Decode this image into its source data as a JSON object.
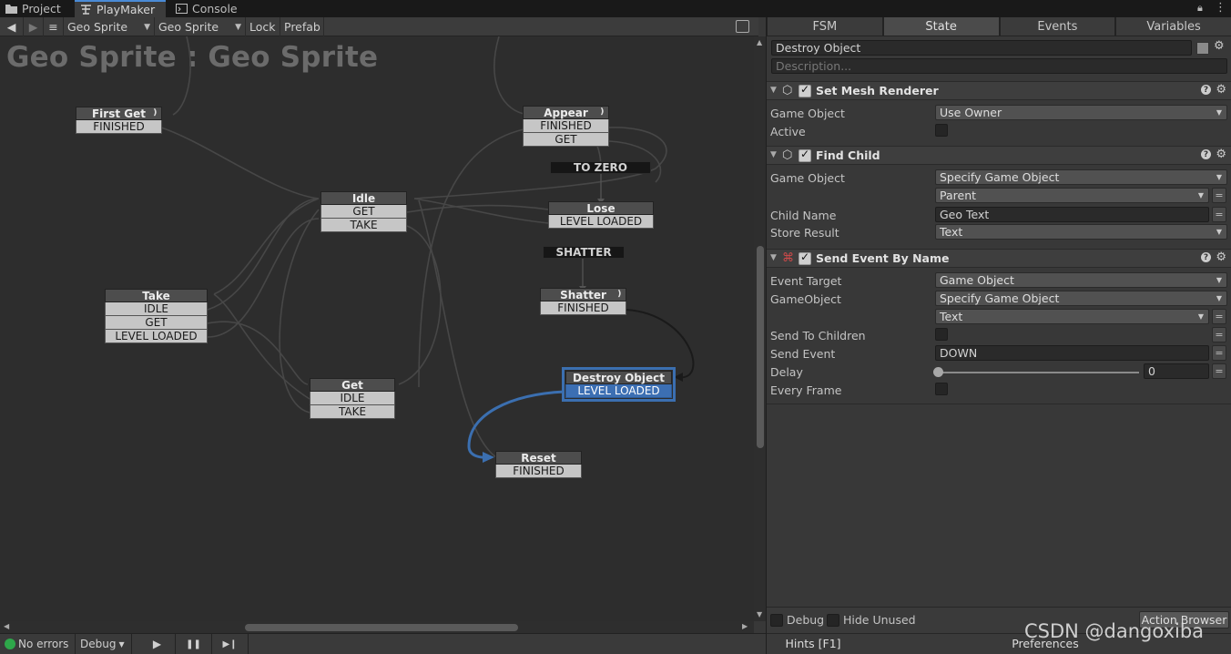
{
  "window_tabs": [
    {
      "label": "Project",
      "icon": "folder-icon"
    },
    {
      "label": "PlayMaker",
      "icon": "playmaker-icon"
    },
    {
      "label": "Console",
      "icon": "console-icon"
    }
  ],
  "toolbar": {
    "back": "◀",
    "forward": "▶",
    "menu": "≡",
    "object_select": "Geo Sprite",
    "fsm_select": "Geo Sprite",
    "lock": "Lock",
    "prefab": "Prefab"
  },
  "graph": {
    "title": "Geo Sprite : Geo Sprite",
    "global_events": [
      "TO ZERO",
      "SHATTER"
    ],
    "states": {
      "first_get": {
        "name": "First Get",
        "events": [
          "FINISHED"
        ]
      },
      "appear": {
        "name": "Appear",
        "events": [
          "FINISHED",
          "GET"
        ]
      },
      "idle": {
        "name": "Idle",
        "events": [
          "GET",
          "TAKE"
        ]
      },
      "lose": {
        "name": "Lose",
        "events": [
          "LEVEL LOADED"
        ]
      },
      "take": {
        "name": "Take",
        "events": [
          "IDLE",
          "GET",
          "LEVEL LOADED"
        ]
      },
      "shatter": {
        "name": "Shatter",
        "events": [
          "FINISHED"
        ]
      },
      "get": {
        "name": "Get",
        "events": [
          "IDLE",
          "TAKE"
        ]
      },
      "destroy_object": {
        "name": "Destroy Object",
        "events": [
          "LEVEL LOADED"
        ]
      },
      "reset": {
        "name": "Reset",
        "events": [
          "FINISHED"
        ]
      }
    }
  },
  "bottombar": {
    "status": "No errors",
    "debug": "Debug",
    "play": "▶",
    "pause": "❚❚",
    "step": "▶❙"
  },
  "panel": {
    "tabs": [
      "FSM",
      "State",
      "Events",
      "Variables"
    ],
    "state_name": "Destroy Object",
    "description_placeholder": "Description...",
    "actions": {
      "set_mesh_renderer": {
        "title": "Set Mesh Renderer",
        "game_object_label": "Game Object",
        "game_object_value": "Use Owner",
        "active_label": "Active"
      },
      "find_child": {
        "title": "Find Child",
        "game_object_label": "Game Object",
        "game_object_value": "Specify Game Object",
        "parent_value": "Parent",
        "child_name_label": "Child Name",
        "child_name_value": "Geo Text",
        "store_result_label": "Store Result",
        "store_result_value": "Text"
      },
      "send_event_by_name": {
        "title": "Send Event By Name",
        "event_target_label": "Event Target",
        "event_target_value": "Game Object",
        "gameobject_label": "GameObject",
        "gameobject_value": "Specify Game Object",
        "text_value": "Text",
        "send_to_children_label": "Send To Children",
        "send_event_label": "Send Event",
        "send_event_value": "DOWN",
        "delay_label": "Delay",
        "delay_value": "0",
        "every_frame_label": "Every Frame"
      }
    },
    "footer": {
      "debug": "Debug",
      "hide_unused": "Hide Unused",
      "action_browser": "Action Browser",
      "hints": "Hints [F1]",
      "preferences": "Preferences"
    }
  },
  "watermark": "CSDN @dangoxiba",
  "colors": {
    "selection": "#3b6fb0",
    "graph_bg": "#2d2d2d",
    "panel_bg": "#383838",
    "ok": "#2ea74a"
  }
}
